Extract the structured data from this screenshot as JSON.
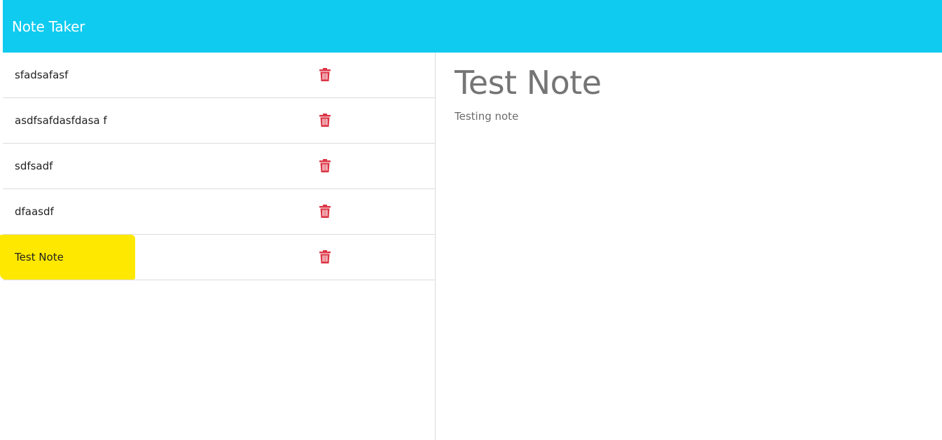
{
  "app": {
    "title": "Note Taker",
    "accent_color": "#0ecbef",
    "delete_color": "#dc3545",
    "highlight_color": "#ffe800"
  },
  "notes": [
    {
      "title": "sfadsafasf",
      "delete_icon": "trash-icon",
      "highlighted": false
    },
    {
      "title": "asdfsafdasfdasa f",
      "delete_icon": "trash-icon",
      "highlighted": false
    },
    {
      "title": "sdfsadf",
      "delete_icon": "trash-icon",
      "highlighted": false
    },
    {
      "title": "dfaasdf",
      "delete_icon": "trash-icon",
      "highlighted": false
    },
    {
      "title": "Test Note",
      "delete_icon": "trash-icon",
      "highlighted": true
    }
  ],
  "active_note": {
    "title": "Test Note",
    "text": "Testing note"
  }
}
